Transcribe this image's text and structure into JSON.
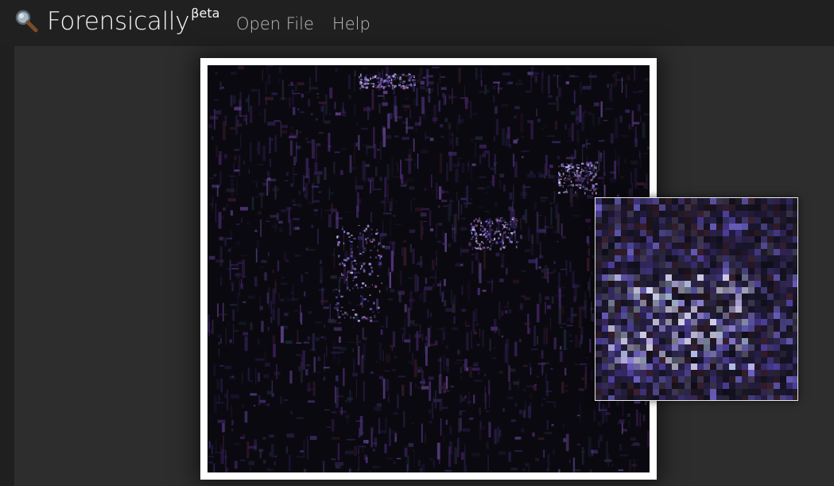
{
  "app": {
    "title": "Forensically",
    "superscript": "βeta",
    "logo_icon": "magnifying-glass-icon"
  },
  "nav": {
    "open_file": "Open File",
    "help": "Help"
  },
  "viewer": {
    "image_view": "error-level-analysis-noise",
    "magnifier_icon": "zoom-loupe"
  },
  "colors": {
    "header_bg": "#202020",
    "workspace_bg": "#2d2d2d",
    "frame": "#ffffff",
    "nav_text": "#bdbdbd",
    "title_text": "#f4f4f4"
  }
}
